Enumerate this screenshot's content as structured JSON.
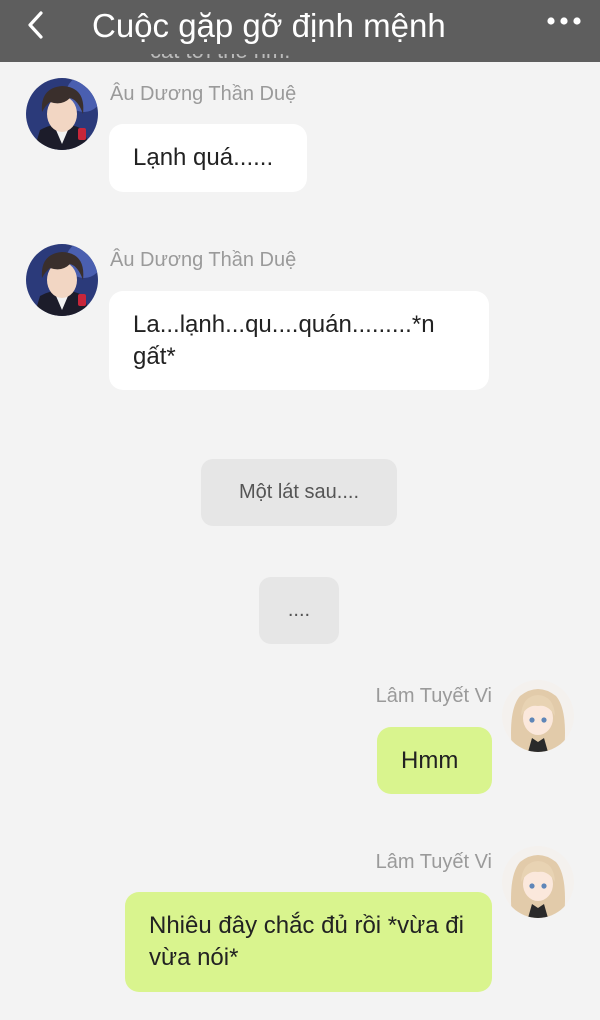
{
  "header": {
    "title": "Cuộc gặp gỡ định mệnh",
    "back_icon": "chevron-left-icon",
    "more_icon": "more-dots-icon"
  },
  "peek_text": "cắt tới thế hm.",
  "messages": [
    {
      "side": "left",
      "sender": "Âu Dương Thần Duệ",
      "text": "Lạnh quá......"
    },
    {
      "side": "left",
      "sender": "Âu Dương Thần Duệ",
      "text": "La...lạnh...qu....quán.........*n gất*"
    },
    {
      "side": "system",
      "text": "Một lát sau...."
    },
    {
      "side": "system",
      "text": "...."
    },
    {
      "side": "right",
      "sender": "Lâm Tuyết Vi",
      "text": "Hmm"
    },
    {
      "side": "right",
      "sender": "Lâm Tuyết Vi",
      "text": "Nhiêu đây chắc đủ rồi *vừa đi vừa nói*"
    }
  ],
  "colors": {
    "header_bg": "#5e5e5e",
    "background": "#f3f3f3",
    "left_bubble": "#ffffff",
    "right_bubble": "#d9f48e",
    "system_bubble": "#e6e6e6"
  }
}
